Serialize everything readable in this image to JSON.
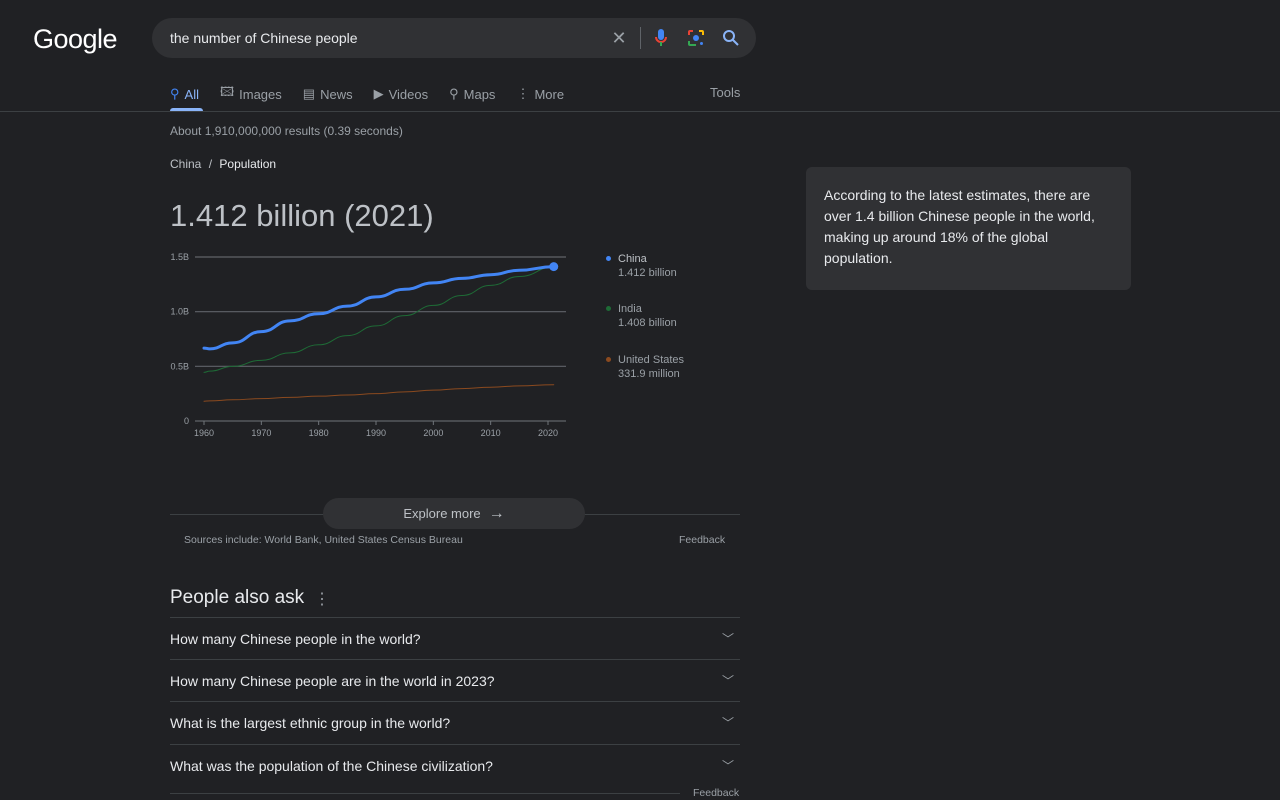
{
  "logo": "Google",
  "search": {
    "query": "the number of Chinese people",
    "icons": [
      "close-icon",
      "mic-icon",
      "lens-icon",
      "search-icon"
    ]
  },
  "tabs": [
    {
      "label": "All",
      "icon": "search-icon"
    },
    {
      "label": "Images",
      "icon": "image-icon"
    },
    {
      "label": "News",
      "icon": "news-icon"
    },
    {
      "label": "Videos",
      "icon": "play-icon"
    },
    {
      "label": "Maps",
      "icon": "pin-icon"
    },
    {
      "label": "More",
      "icon": "dots-icon"
    }
  ],
  "tools": "Tools",
  "stats": "About 1,910,000,000 results (0.39 seconds)",
  "breadcrumb": {
    "parent": "China",
    "sep": "/",
    "current": "Population"
  },
  "answer": "1.412 billion (2021)",
  "colors": {
    "china": "#4285f4",
    "india": "#1e6b36",
    "us": "#8b4a1f",
    "accent": "#8ab4f8"
  },
  "chart_data": {
    "type": "line",
    "xlim": [
      1960,
      2021
    ],
    "ylim": [
      0,
      1.5
    ],
    "x_ticks": [
      "1960",
      "1970",
      "1980",
      "1990",
      "2000",
      "2010",
      "2020"
    ],
    "y_ticks": [
      "0",
      "0.5B",
      "1.0B",
      "1.5B"
    ],
    "grid": true,
    "legend": "right",
    "x": [
      1960,
      1961,
      1965,
      1970,
      1975,
      1980,
      1985,
      1990,
      1995,
      2000,
      2005,
      2010,
      2015,
      2021
    ],
    "series": [
      {
        "name": "China",
        "value_label": "1.412 billion",
        "values": [
          0.667,
          0.66,
          0.715,
          0.818,
          0.916,
          0.981,
          1.051,
          1.135,
          1.205,
          1.263,
          1.304,
          1.338,
          1.379,
          1.412
        ]
      },
      {
        "name": "India",
        "value_label": "1.408 billion",
        "values": [
          0.445,
          0.456,
          0.5,
          0.555,
          0.623,
          0.697,
          0.781,
          0.87,
          0.964,
          1.057,
          1.148,
          1.241,
          1.322,
          1.408
        ]
      },
      {
        "name": "United States",
        "value_label": "331.9 million",
        "values": [
          0.181,
          0.184,
          0.194,
          0.205,
          0.216,
          0.227,
          0.238,
          0.25,
          0.266,
          0.282,
          0.296,
          0.309,
          0.321,
          0.332
        ]
      }
    ]
  },
  "explore": "Explore more",
  "sources": "Sources include: World Bank, United States Census Bureau",
  "feedback": "Feedback",
  "paa": {
    "title": "People also ask",
    "questions": [
      "How many Chinese people in the world?",
      "How many Chinese people are in the world in 2023?",
      "What is the largest ethnic group in the world?",
      "What was the population of the Chinese civilization?"
    ]
  },
  "side": "According to the latest estimates, there are over 1.4 billion Chinese people in the world, making up around 18% of the global population."
}
